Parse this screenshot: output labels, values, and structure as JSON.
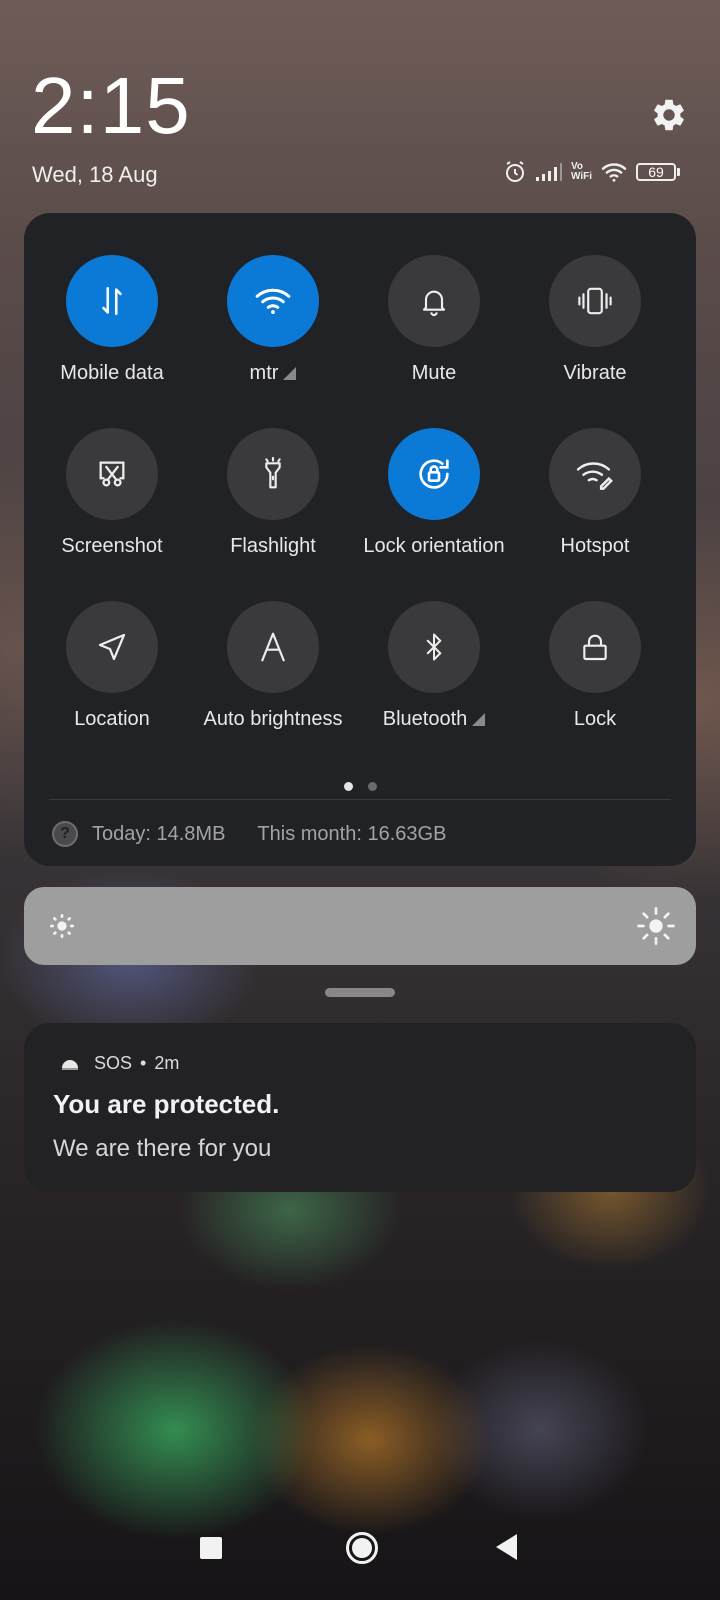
{
  "status_header": {
    "time": "2:15",
    "date": "Wed, 18 Aug",
    "battery_level": "69",
    "icons": [
      "alarm-icon",
      "signal-icon",
      "vowifi-icon",
      "wifi-icon",
      "battery-icon"
    ],
    "vowifi_top": "Vo",
    "vowifi_bottom": "WiFi"
  },
  "quick_settings": {
    "tiles": [
      {
        "label": "Mobile data",
        "icon": "mobile-data-icon",
        "active": true
      },
      {
        "label": "mtr",
        "icon": "wifi-icon",
        "active": true,
        "has_indicator": true
      },
      {
        "label": "Mute",
        "icon": "bell-icon",
        "active": false
      },
      {
        "label": "Vibrate",
        "icon": "vibrate-icon",
        "active": false
      },
      {
        "label": "Screenshot",
        "icon": "screenshot-icon",
        "active": false
      },
      {
        "label": "Flashlight",
        "icon": "flashlight-icon",
        "active": false
      },
      {
        "label": "Lock orientation",
        "icon": "rotation-lock-icon",
        "active": true
      },
      {
        "label": "Hotspot",
        "icon": "hotspot-icon",
        "active": false
      },
      {
        "label": "Location",
        "icon": "location-icon",
        "active": false
      },
      {
        "label": "Auto brightness",
        "icon": "auto-brightness-icon",
        "active": false
      },
      {
        "label": "Bluetooth",
        "icon": "bluetooth-icon",
        "active": false,
        "has_indicator": true
      },
      {
        "label": "Lock",
        "icon": "lock-icon",
        "active": false
      }
    ],
    "page_count": 2,
    "current_page": 1,
    "data_usage": {
      "today": "Today: 14.8MB",
      "month": "This month: 16.63GB",
      "help_glyph": "?"
    }
  },
  "notification": {
    "app_name": "SOS",
    "separator": "•",
    "time": "2m",
    "title": "You are protected.",
    "body": "We are there for you"
  },
  "colors": {
    "accent": "#0b79d6",
    "tile_inactive": "#3a3a3d",
    "panel_bg": "#212225"
  }
}
